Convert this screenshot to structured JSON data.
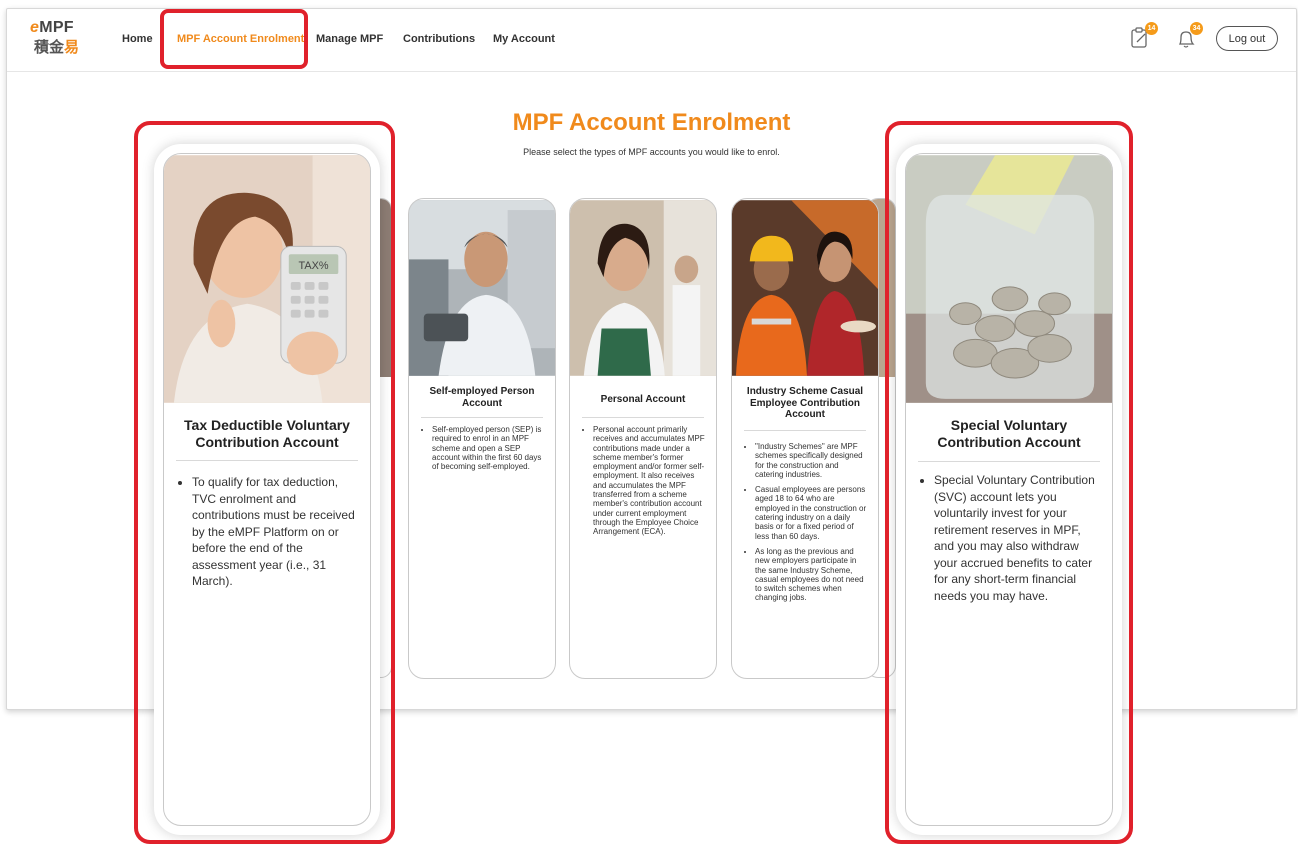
{
  "logo": {
    "line1_e": "e",
    "line1_mpf": "MPF",
    "line2_a": "積金",
    "line2_b": "易"
  },
  "nav": {
    "home": "Home",
    "enrolment": "MPF Account Enrolment",
    "manage": "Manage MPF",
    "contributions": "Contributions",
    "account": "My Account"
  },
  "icons": {
    "clipboard_badge": "14",
    "bell_badge": "34",
    "accent": "#f08a1c",
    "highlight": "#e0212b"
  },
  "logout_label": "Log out",
  "page": {
    "title": "MPF Account Enrolment",
    "subtitle": "Please select the types of MPF accounts you would like to enrol."
  },
  "cards": {
    "tvc": {
      "title": "Tax Deductible Voluntary Contribution Account",
      "bullets": [
        "To qualify for tax deduction, TVC enrolment and contributions must be received by the eMPF Platform on or before the end of the assessment year (i.e., 31 March)."
      ],
      "calc_text": "TAX%"
    },
    "sep": {
      "title": "Self-employed Person Account",
      "bullets": [
        "Self-employed person (SEP) is required to enrol in an MPF scheme and open a SEP account within the first 60 days of becoming self-employed."
      ]
    },
    "personal": {
      "title": "Personal Account",
      "bullets": [
        "Personal account primarily receives and accumulates MPF contributions made under a scheme member's former employment and/or former self-employment. It also receives and accumulates the MPF transferred from a scheme member's contribution account under current employment through the Employee Choice Arrangement (ECA)."
      ]
    },
    "industry": {
      "title": "Industry Scheme Casual Employee Contribution Account",
      "bullets": [
        "\"Industry Schemes\" are MPF schemes specifically designed for the construction and catering industries.",
        "Casual employees are persons aged 18 to 64 who are employed in the construction or catering industry on a daily basis or for a fixed period of less than 60 days.",
        "As long as the previous and new employers participate in the same Industry Scheme, casual employees do not need to switch schemes when changing jobs."
      ]
    },
    "svc": {
      "title": "Special Voluntary Contribution Account",
      "bullets": [
        "Special Voluntary Contribution (SVC) account lets you voluntarily invest for your retirement reserves in MPF, and you may also withdraw your accrued benefits to cater for any short-term financial needs you may have."
      ]
    }
  }
}
